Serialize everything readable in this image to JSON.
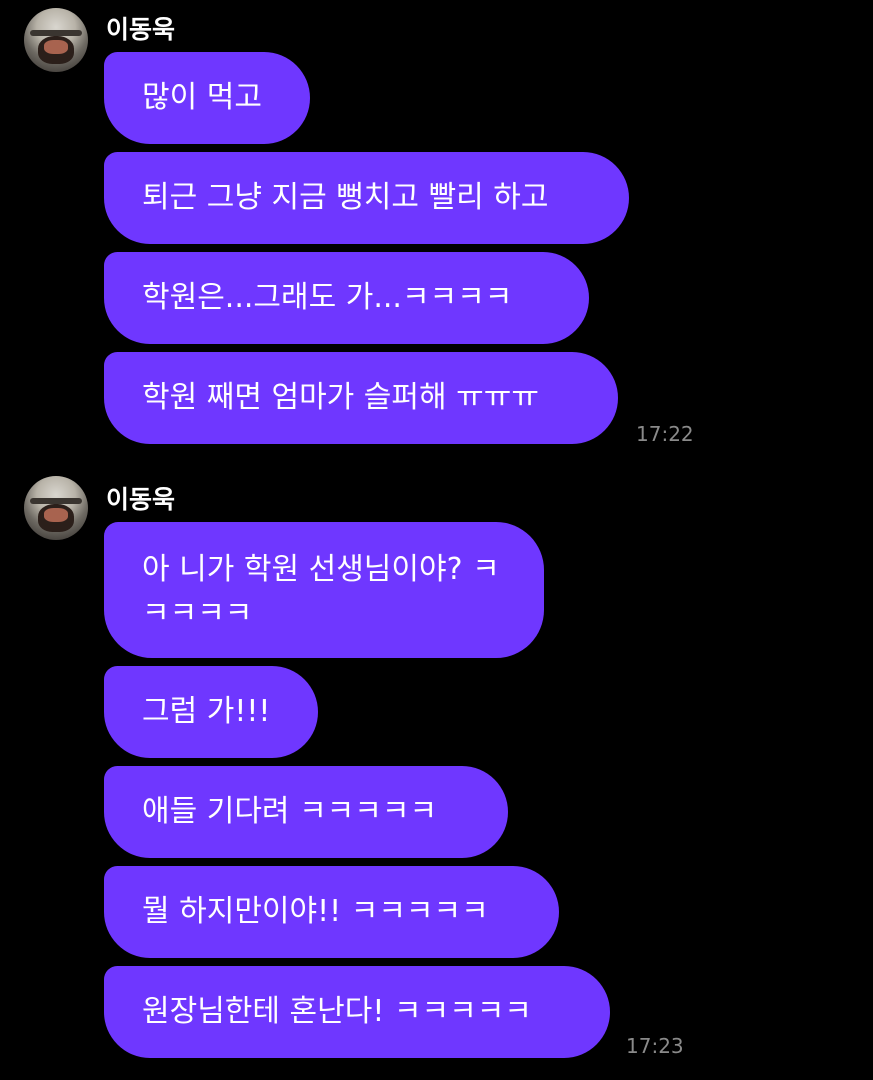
{
  "groups": [
    {
      "sender": "이동욱",
      "messages": [
        "많이 먹고",
        "퇴근 그냥 지금 뻥치고 빨리 하고",
        "학원은...그래도 가...ㅋㅋㅋㅋ",
        "학원 째면 엄마가 슬퍼해 ㅠㅠㅠ"
      ],
      "time": "17:22"
    },
    {
      "sender": "이동욱",
      "messages": [
        "아 니가 학원 선생님이야? ㅋㅋㅋㅋㅋ",
        "그럼 가!!!",
        "애들 기다려 ㅋㅋㅋㅋㅋ",
        "뭘 하지만이야!! ㅋㅋㅋㅋㅋ",
        "원장님한테 혼난다! ㅋㅋㅋㅋㅋ"
      ],
      "time": "17:23"
    }
  ]
}
